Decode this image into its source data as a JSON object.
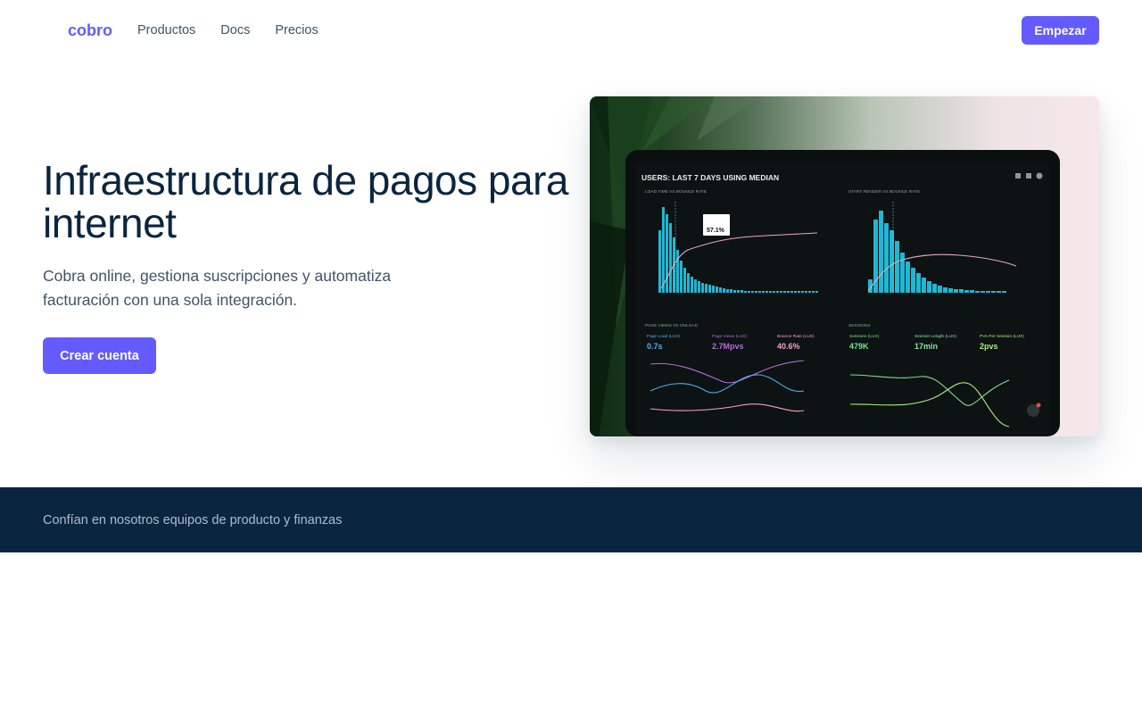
{
  "brand": {
    "logo": "cobro",
    "accent": "#635bff",
    "dark": "#0a2540"
  },
  "nav": {
    "items": [
      "Productos",
      "Docs",
      "Precios"
    ],
    "cta": "Empezar"
  },
  "hero": {
    "title": "Infraestructura de pagos para internet",
    "subtitle": "Cobra online, gestiona suscripciones y automatiza facturación con una sola integración.",
    "cta": "Crear cuenta"
  },
  "dashboard_image": {
    "header": "USERS: LAST 7 DAYS USING MEDIAN",
    "panel1_title": "LOAD TIME VS BOUNCE RATE",
    "panel2_title": "START RENDER VS BOUNCE RATE",
    "tooltip": "57.1%",
    "panel3_title": "PAGE VIEWS VS ONLOAD",
    "panel4_title": "SESSIONS",
    "metrics_left": [
      {
        "label": "Page Load (LUX)",
        "value": "0.7s"
      },
      {
        "label": "Page Views (LUX)",
        "value": "2.7Mpvs"
      },
      {
        "label": "Bounce Rate (LUX)",
        "value": "40.6%"
      }
    ],
    "metrics_right": [
      {
        "label": "Sessions (LUX)",
        "value": "479K"
      },
      {
        "label": "Session Length (LUX)",
        "value": "17min"
      },
      {
        "label": "PVs Per Session (LUX)",
        "value": "2pvs"
      }
    ]
  },
  "trust": {
    "text": "Confían en nosotros equipos de producto y finanzas"
  }
}
